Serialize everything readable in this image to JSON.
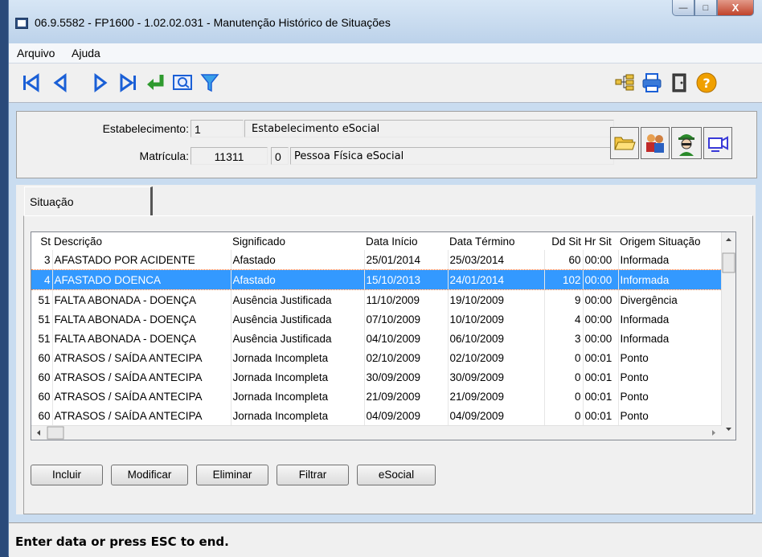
{
  "window": {
    "title": "06.9.5582 - FP1600 - 1.02.02.031 - Manutenção Histórico de Situações",
    "min_label": "—",
    "max_label": "□",
    "close_label": "X"
  },
  "menu": [
    {
      "label": "Arquivo"
    },
    {
      "label": "Ajuda"
    }
  ],
  "toolbar": {
    "left_icons": [
      "first-record-icon",
      "prev-record-icon",
      "next-record-icon",
      "last-record-icon",
      "goto-icon",
      "search-icon",
      "filter-icon"
    ],
    "right_icons": [
      "tree-icon",
      "print-icon",
      "exit-icon",
      "help-icon"
    ]
  },
  "header": {
    "estab_label": "Estabelecimento:",
    "estab_code": "1",
    "estab_name": "Estabelecimento eSocial",
    "matricula_label": "Matrícula:",
    "matricula": "11311",
    "matricula_dv": "0",
    "pessoa_name": "Pessoa Física eSocial"
  },
  "tab": {
    "label": "Situação"
  },
  "grid": {
    "columns": [
      "St",
      "Descrição",
      "Significado",
      "Data Início",
      "Data Término",
      "Dd Sit",
      "Hr Sit",
      "Origem Situação"
    ],
    "rows": [
      {
        "st": "3",
        "desc": "AFASTADO POR ACIDENTE",
        "sig": "Afastado",
        "ini": "25/01/2014",
        "fim": "25/03/2014",
        "dd": "60",
        "hr": "00:00",
        "orig": "Informada",
        "selected": false
      },
      {
        "st": "4",
        "desc": "AFASTADO DOENCA",
        "sig": "Afastado",
        "ini": "15/10/2013",
        "fim": "24/01/2014",
        "dd": "102",
        "hr": "00:00",
        "orig": "Informada",
        "selected": true
      },
      {
        "st": "51",
        "desc": "FALTA ABONADA - DOENÇA",
        "sig": "Ausência Justificada",
        "ini": "11/10/2009",
        "fim": "19/10/2009",
        "dd": "9",
        "hr": "00:00",
        "orig": "Divergência",
        "selected": false
      },
      {
        "st": "51",
        "desc": "FALTA ABONADA - DOENÇA",
        "sig": "Ausência Justificada",
        "ini": "07/10/2009",
        "fim": "10/10/2009",
        "dd": "4",
        "hr": "00:00",
        "orig": "Informada",
        "selected": false
      },
      {
        "st": "51",
        "desc": "FALTA ABONADA - DOENÇA",
        "sig": "Ausência Justificada",
        "ini": "04/10/2009",
        "fim": "06/10/2009",
        "dd": "3",
        "hr": "00:00",
        "orig": "Informada",
        "selected": false
      },
      {
        "st": "60",
        "desc": "ATRASOS / SAÍDA ANTECIPA",
        "sig": "Jornada Incompleta",
        "ini": "02/10/2009",
        "fim": "02/10/2009",
        "dd": "0",
        "hr": "00:01",
        "orig": "Ponto",
        "selected": false
      },
      {
        "st": "60",
        "desc": "ATRASOS / SAÍDA ANTECIPA",
        "sig": "Jornada Incompleta",
        "ini": "30/09/2009",
        "fim": "30/09/2009",
        "dd": "0",
        "hr": "00:01",
        "orig": "Ponto",
        "selected": false
      },
      {
        "st": "60",
        "desc": "ATRASOS / SAÍDA ANTECIPA",
        "sig": "Jornada Incompleta",
        "ini": "21/09/2009",
        "fim": "21/09/2009",
        "dd": "0",
        "hr": "00:01",
        "orig": "Ponto",
        "selected": false
      },
      {
        "st": "60",
        "desc": "ATRASOS / SAÍDA ANTECIPA",
        "sig": "Jornada Incompleta",
        "ini": "04/09/2009",
        "fim": "04/09/2009",
        "dd": "0",
        "hr": "00:01",
        "orig": "Ponto",
        "selected": false
      }
    ]
  },
  "buttons": [
    {
      "label": "Incluir"
    },
    {
      "label": "Modificar"
    },
    {
      "label": "Eliminar"
    },
    {
      "label": "Filtrar"
    },
    {
      "label": "eSocial"
    }
  ],
  "status": {
    "text": "Enter data or press ESC to end."
  },
  "colors": {
    "selection": "#3399ff",
    "toolbar_blue": "#1a5fd6",
    "help_orange": "#f0a000"
  }
}
